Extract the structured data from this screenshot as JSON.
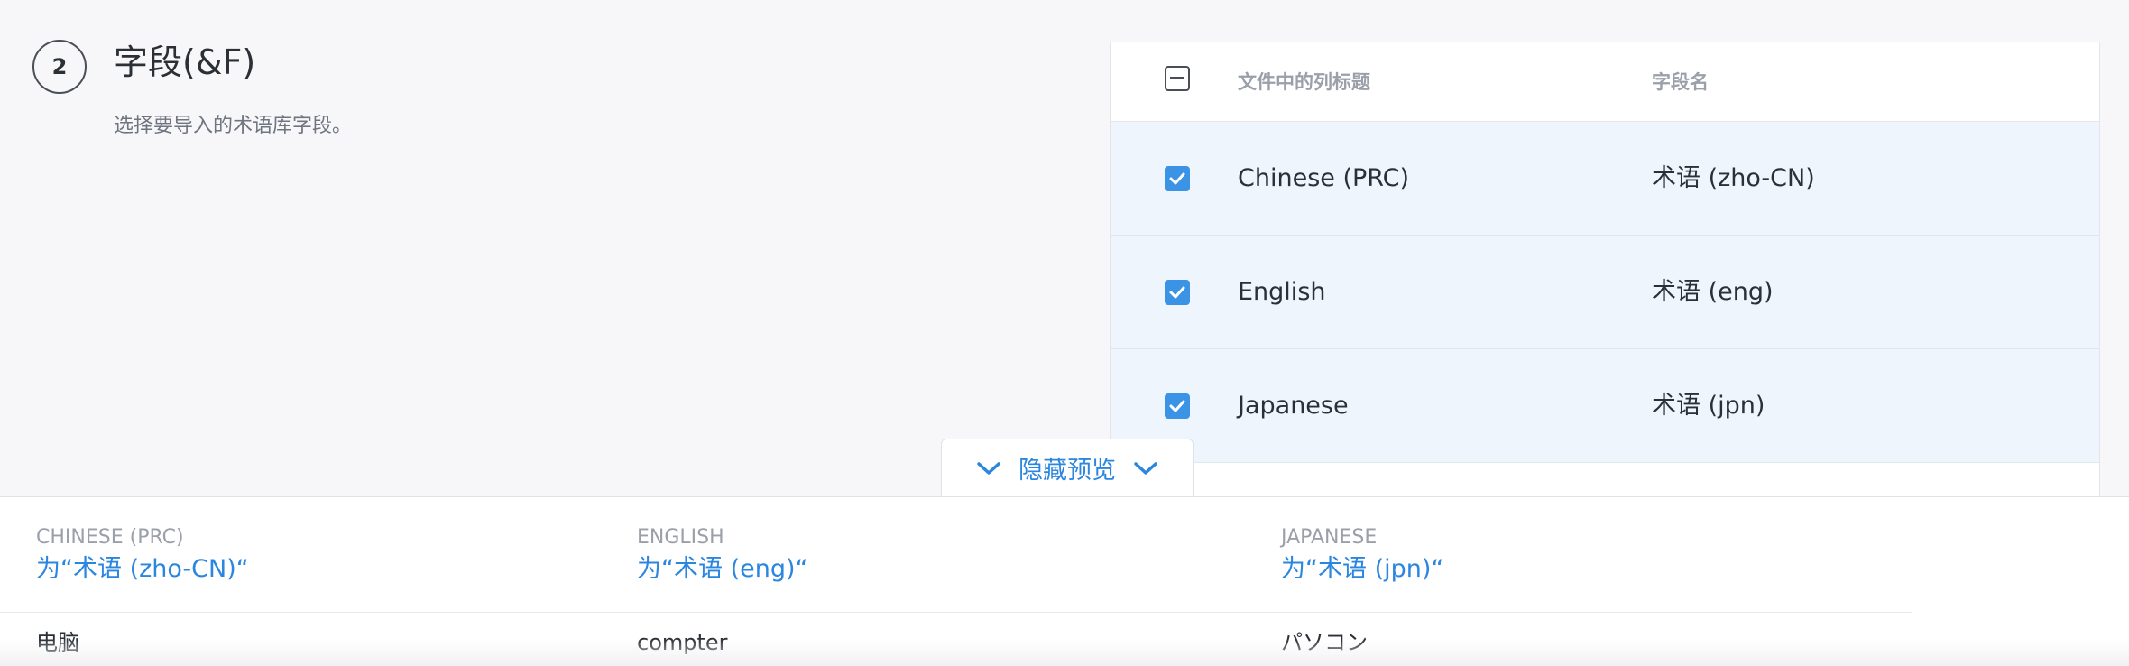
{
  "step": {
    "number": "2",
    "title": "字段(&F)",
    "description": "选择要导入的术语库字段。"
  },
  "field_table": {
    "header": {
      "column_title": "文件中的列标题",
      "field_name": "字段名"
    },
    "rows": [
      {
        "column_title": "Chinese (PRC)",
        "field_name": "术语 (zho-CN)",
        "checked": true
      },
      {
        "column_title": "English",
        "field_name": "术语 (eng)",
        "checked": true
      },
      {
        "column_title": "Japanese",
        "field_name": "术语 (jpn)",
        "checked": true
      }
    ]
  },
  "toggle_preview": {
    "label": "隐藏预览"
  },
  "preview": {
    "columns": [
      {
        "name": "CHINESE (PRC)",
        "mapping": "为“术语 (zho-CN)“",
        "value": "电脑"
      },
      {
        "name": "ENGLISH",
        "mapping": "为“术语 (eng)“",
        "value": "compter"
      },
      {
        "name": "JAPANESE",
        "mapping": "为“术语 (jpn)“",
        "value": "パソコン"
      }
    ]
  },
  "colors": {
    "accent": "#3b93e6",
    "link": "#2b86df",
    "row_bg": "#eef5fc"
  }
}
